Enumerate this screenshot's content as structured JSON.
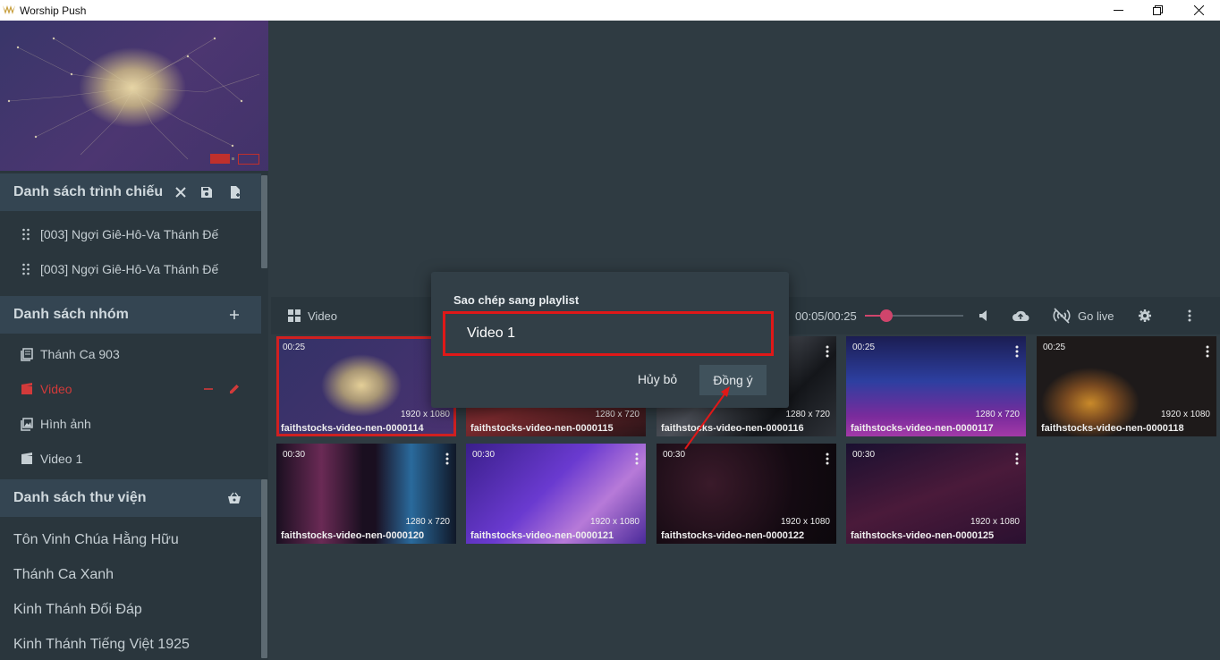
{
  "app": {
    "title": "Worship Push"
  },
  "presentation_list": {
    "title": "Danh sách trình chiếu",
    "items": [
      "[003] Ngợi Giê-Hô-Va Thánh Đế",
      "[003] Ngợi Giê-Hô-Va Thánh Đế"
    ]
  },
  "group_list": {
    "title": "Danh sách nhóm",
    "items": [
      {
        "label": "Thánh Ca 903",
        "icon": "book-icon"
      },
      {
        "label": "Video",
        "icon": "film-icon",
        "active": true
      },
      {
        "label": "Hình ảnh",
        "icon": "image-icon"
      },
      {
        "label": "Video 1",
        "icon": "film-icon"
      }
    ]
  },
  "library_list": {
    "title": "Danh sách thư viện",
    "items": [
      "Tôn Vinh Chúa Hằng Hữu",
      "Thánh Ca Xanh",
      "Kinh Thánh Đối Đáp",
      "Kinh Thánh Tiếng Việt 1925"
    ]
  },
  "toolbar": {
    "view_label": "Video",
    "time": "00:05/00:25",
    "progress": 0.2,
    "golive_label": "Go live"
  },
  "videos": [
    {
      "duration": "00:25",
      "resolution": "1920 x 1080",
      "name": "faithstocks-video-nen-0000114",
      "selected": true
    },
    {
      "duration": "",
      "resolution": "1280 x 720",
      "name": "faithstocks-video-nen-0000115"
    },
    {
      "duration": "",
      "resolution": "1280 x 720",
      "name": "faithstocks-video-nen-0000116"
    },
    {
      "duration": "00:25",
      "resolution": "1280 x 720",
      "name": "faithstocks-video-nen-0000117"
    },
    {
      "duration": "00:25",
      "resolution": "1920 x 1080",
      "name": "faithstocks-video-nen-0000118"
    },
    {
      "duration": "00:30",
      "resolution": "1280 x 720",
      "name": "faithstocks-video-nen-0000120"
    },
    {
      "duration": "00:30",
      "resolution": "1920 x 1080",
      "name": "faithstocks-video-nen-0000121"
    },
    {
      "duration": "00:30",
      "resolution": "1920 x 1080",
      "name": "faithstocks-video-nen-0000122"
    },
    {
      "duration": "00:30",
      "resolution": "1920 x 1080",
      "name": "faithstocks-video-nen-0000125"
    }
  ],
  "dialog": {
    "title": "Sao chép sang playlist",
    "value": "Video 1",
    "cancel_label": "Hủy bỏ",
    "ok_label": "Đồng ý"
  },
  "colors": {
    "accent": "#d0456c",
    "highlight": "#e01818",
    "active_group": "#d23a3a"
  }
}
